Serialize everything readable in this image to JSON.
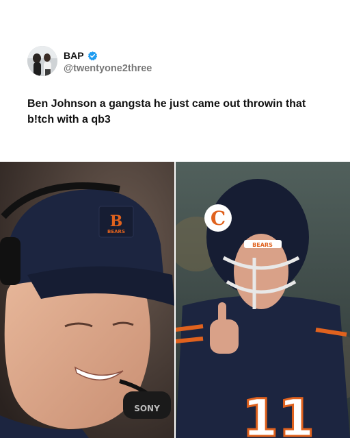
{
  "tweet": {
    "display_name": "BAP",
    "handle": "@twentyone2three",
    "verified": true,
    "verified_color": "#1d9bf0",
    "text": "Ben Johnson a gangsta he just came out throwin that b!tch with a qb3"
  },
  "photos": {
    "left": {
      "logo": "B",
      "patch_text": "BEARS",
      "headset_brand": "SONY"
    },
    "right": {
      "helmet_logo": "C",
      "helmet_stripe_text": "BEARS",
      "jersey_number": "11"
    }
  },
  "colors": {
    "bears_navy": "#1c2540",
    "bears_orange": "#e0621e"
  }
}
